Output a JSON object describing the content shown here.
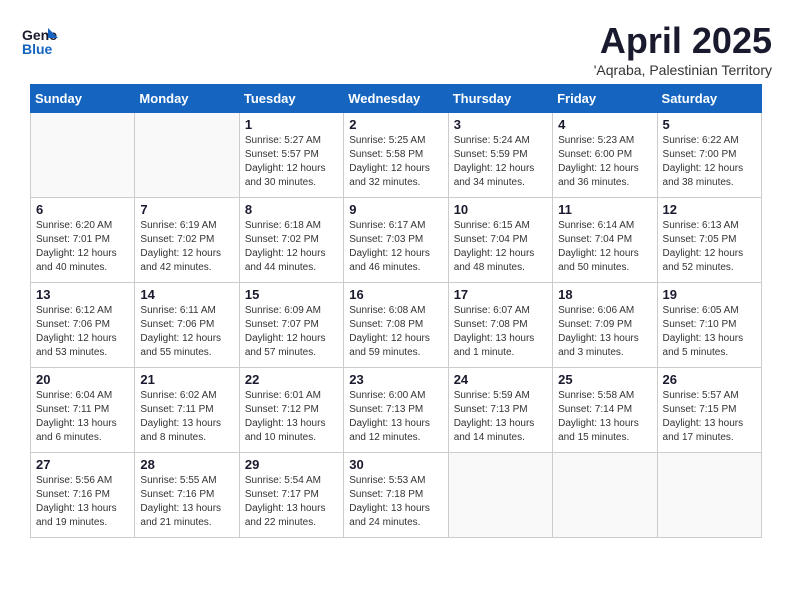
{
  "logo": {
    "line1": "General",
    "line2": "Blue"
  },
  "title": "April 2025",
  "subtitle": "'Aqraba, Palestinian Territory",
  "days_header": [
    "Sunday",
    "Monday",
    "Tuesday",
    "Wednesday",
    "Thursday",
    "Friday",
    "Saturday"
  ],
  "weeks": [
    [
      {
        "day": "",
        "info": ""
      },
      {
        "day": "",
        "info": ""
      },
      {
        "day": "1",
        "info": "Sunrise: 5:27 AM\nSunset: 5:57 PM\nDaylight: 12 hours\nand 30 minutes."
      },
      {
        "day": "2",
        "info": "Sunrise: 5:25 AM\nSunset: 5:58 PM\nDaylight: 12 hours\nand 32 minutes."
      },
      {
        "day": "3",
        "info": "Sunrise: 5:24 AM\nSunset: 5:59 PM\nDaylight: 12 hours\nand 34 minutes."
      },
      {
        "day": "4",
        "info": "Sunrise: 5:23 AM\nSunset: 6:00 PM\nDaylight: 12 hours\nand 36 minutes."
      },
      {
        "day": "5",
        "info": "Sunrise: 6:22 AM\nSunset: 7:00 PM\nDaylight: 12 hours\nand 38 minutes."
      }
    ],
    [
      {
        "day": "6",
        "info": "Sunrise: 6:20 AM\nSunset: 7:01 PM\nDaylight: 12 hours\nand 40 minutes."
      },
      {
        "day": "7",
        "info": "Sunrise: 6:19 AM\nSunset: 7:02 PM\nDaylight: 12 hours\nand 42 minutes."
      },
      {
        "day": "8",
        "info": "Sunrise: 6:18 AM\nSunset: 7:02 PM\nDaylight: 12 hours\nand 44 minutes."
      },
      {
        "day": "9",
        "info": "Sunrise: 6:17 AM\nSunset: 7:03 PM\nDaylight: 12 hours\nand 46 minutes."
      },
      {
        "day": "10",
        "info": "Sunrise: 6:15 AM\nSunset: 7:04 PM\nDaylight: 12 hours\nand 48 minutes."
      },
      {
        "day": "11",
        "info": "Sunrise: 6:14 AM\nSunset: 7:04 PM\nDaylight: 12 hours\nand 50 minutes."
      },
      {
        "day": "12",
        "info": "Sunrise: 6:13 AM\nSunset: 7:05 PM\nDaylight: 12 hours\nand 52 minutes."
      }
    ],
    [
      {
        "day": "13",
        "info": "Sunrise: 6:12 AM\nSunset: 7:06 PM\nDaylight: 12 hours\nand 53 minutes."
      },
      {
        "day": "14",
        "info": "Sunrise: 6:11 AM\nSunset: 7:06 PM\nDaylight: 12 hours\nand 55 minutes."
      },
      {
        "day": "15",
        "info": "Sunrise: 6:09 AM\nSunset: 7:07 PM\nDaylight: 12 hours\nand 57 minutes."
      },
      {
        "day": "16",
        "info": "Sunrise: 6:08 AM\nSunset: 7:08 PM\nDaylight: 12 hours\nand 59 minutes."
      },
      {
        "day": "17",
        "info": "Sunrise: 6:07 AM\nSunset: 7:08 PM\nDaylight: 13 hours\nand 1 minute."
      },
      {
        "day": "18",
        "info": "Sunrise: 6:06 AM\nSunset: 7:09 PM\nDaylight: 13 hours\nand 3 minutes."
      },
      {
        "day": "19",
        "info": "Sunrise: 6:05 AM\nSunset: 7:10 PM\nDaylight: 13 hours\nand 5 minutes."
      }
    ],
    [
      {
        "day": "20",
        "info": "Sunrise: 6:04 AM\nSunset: 7:11 PM\nDaylight: 13 hours\nand 6 minutes."
      },
      {
        "day": "21",
        "info": "Sunrise: 6:02 AM\nSunset: 7:11 PM\nDaylight: 13 hours\nand 8 minutes."
      },
      {
        "day": "22",
        "info": "Sunrise: 6:01 AM\nSunset: 7:12 PM\nDaylight: 13 hours\nand 10 minutes."
      },
      {
        "day": "23",
        "info": "Sunrise: 6:00 AM\nSunset: 7:13 PM\nDaylight: 13 hours\nand 12 minutes."
      },
      {
        "day": "24",
        "info": "Sunrise: 5:59 AM\nSunset: 7:13 PM\nDaylight: 13 hours\nand 14 minutes."
      },
      {
        "day": "25",
        "info": "Sunrise: 5:58 AM\nSunset: 7:14 PM\nDaylight: 13 hours\nand 15 minutes."
      },
      {
        "day": "26",
        "info": "Sunrise: 5:57 AM\nSunset: 7:15 PM\nDaylight: 13 hours\nand 17 minutes."
      }
    ],
    [
      {
        "day": "27",
        "info": "Sunrise: 5:56 AM\nSunset: 7:16 PM\nDaylight: 13 hours\nand 19 minutes."
      },
      {
        "day": "28",
        "info": "Sunrise: 5:55 AM\nSunset: 7:16 PM\nDaylight: 13 hours\nand 21 minutes."
      },
      {
        "day": "29",
        "info": "Sunrise: 5:54 AM\nSunset: 7:17 PM\nDaylight: 13 hours\nand 22 minutes."
      },
      {
        "day": "30",
        "info": "Sunrise: 5:53 AM\nSunset: 7:18 PM\nDaylight: 13 hours\nand 24 minutes."
      },
      {
        "day": "",
        "info": ""
      },
      {
        "day": "",
        "info": ""
      },
      {
        "day": "",
        "info": ""
      }
    ]
  ]
}
